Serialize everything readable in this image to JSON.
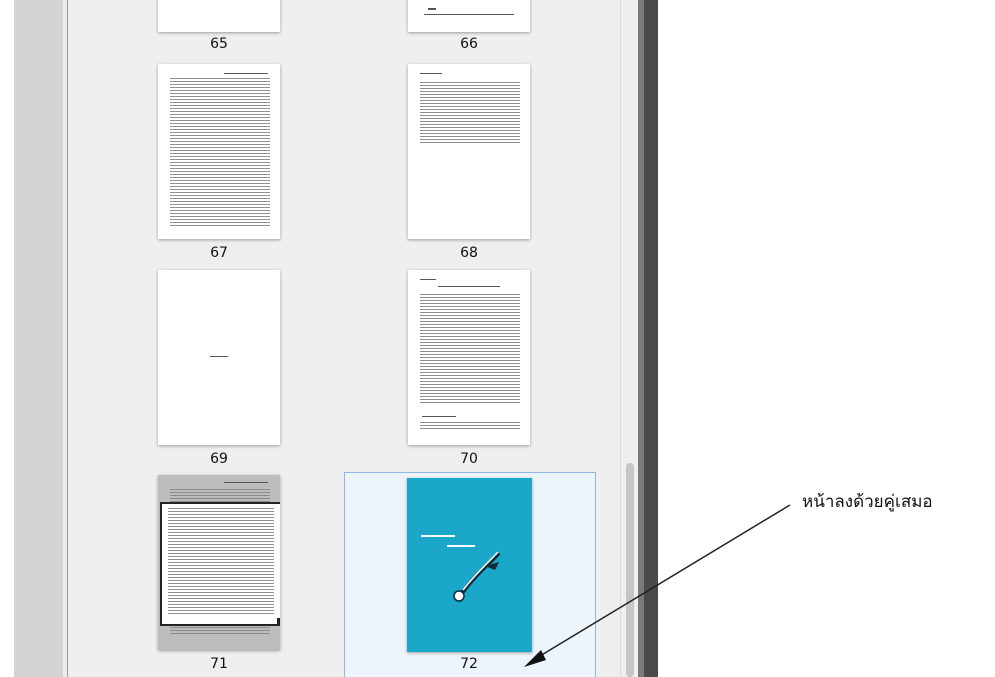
{
  "thumbnails": [
    {
      "page": "65"
    },
    {
      "page": "66"
    },
    {
      "page": "67"
    },
    {
      "page": "68"
    },
    {
      "page": "69"
    },
    {
      "page": "70"
    },
    {
      "page": "71"
    },
    {
      "page": "72"
    }
  ],
  "annotation": {
    "text": "หน้าลงด้วยคู่เสมอ"
  },
  "colors": {
    "cover": "#1aa7c9",
    "selection_border": "#8fb8e6"
  }
}
